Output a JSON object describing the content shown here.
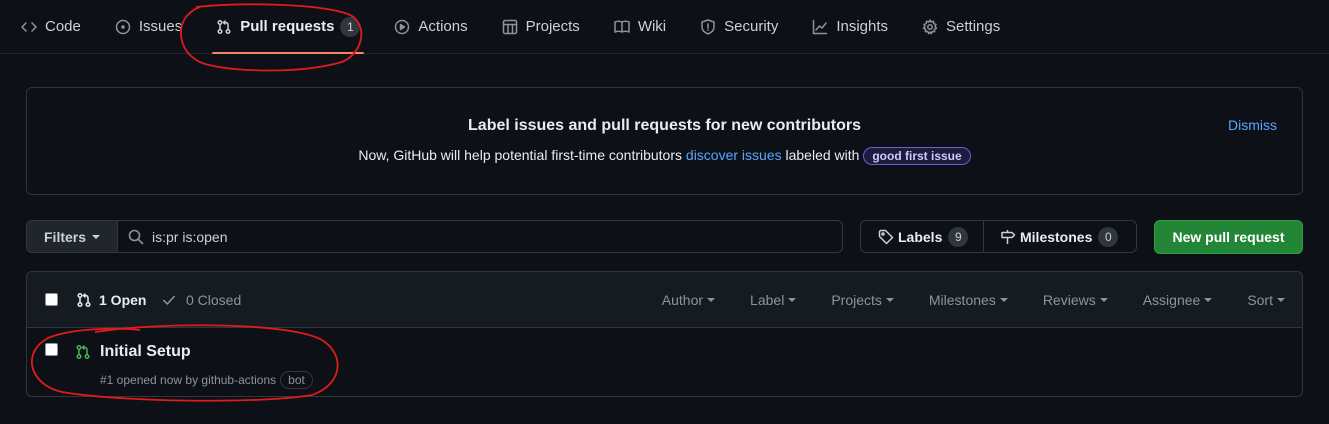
{
  "nav": {
    "tabs": [
      {
        "label": "Code",
        "icon": "code-icon"
      },
      {
        "label": "Issues",
        "icon": "issue-opened-icon"
      },
      {
        "label": "Pull requests",
        "icon": "git-pull-request-icon",
        "count": "1",
        "active": true
      },
      {
        "label": "Actions",
        "icon": "play-icon"
      },
      {
        "label": "Projects",
        "icon": "table-icon"
      },
      {
        "label": "Wiki",
        "icon": "book-icon"
      },
      {
        "label": "Security",
        "icon": "shield-icon"
      },
      {
        "label": "Insights",
        "icon": "graph-icon"
      },
      {
        "label": "Settings",
        "icon": "gear-icon"
      }
    ]
  },
  "banner": {
    "title": "Label issues and pull requests for new contributors",
    "text_before": "Now, GitHub will help potential first-time contributors",
    "link": "discover issues",
    "text_after": "labeled with",
    "label": "good first issue",
    "dismiss": "Dismiss"
  },
  "filterbar": {
    "filters_label": "Filters",
    "search_value": "is:pr is:open",
    "labels_label": "Labels",
    "labels_count": "9",
    "milestones_label": "Milestones",
    "milestones_count": "0",
    "new_pr_label": "New pull request"
  },
  "list": {
    "open_label": "1 Open",
    "closed_label": "0 Closed",
    "sort_menus": [
      "Author",
      "Label",
      "Projects",
      "Milestones",
      "Reviews",
      "Assignee",
      "Sort"
    ],
    "items": [
      {
        "title": "Initial Setup",
        "meta": "#1 opened now by github-actions",
        "badge": "bot"
      }
    ]
  },
  "colors": {
    "accent_tab_underline": "#f78166",
    "open_pr_green": "#3fb950",
    "primary_button": "#238636",
    "link_blue": "#58a6ff",
    "annotation_red": "#e01b1b"
  }
}
